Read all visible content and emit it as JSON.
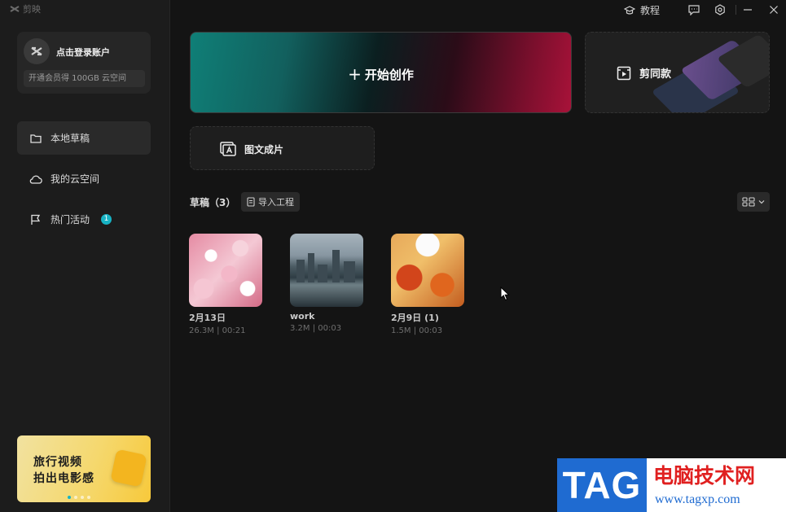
{
  "app": {
    "name": "剪映"
  },
  "topbar": {
    "tutorial_label": "教程"
  },
  "sidebar": {
    "login_label": "点击登录账户",
    "vip_text": "开通会员得 100GB 云空间",
    "items": [
      {
        "label": "本地草稿",
        "icon": "folder-icon",
        "active": true
      },
      {
        "label": "我的云空间",
        "icon": "cloud-icon",
        "active": false
      },
      {
        "label": "热门活动",
        "icon": "flag-icon",
        "active": false,
        "badge": "1"
      }
    ],
    "promo": {
      "line1": "旅行视频",
      "line2": "拍出电影感"
    }
  },
  "main": {
    "create_label": "开始创作",
    "template_label": "剪同款",
    "img2vid_label": "图文成片",
    "drafts_title": "草稿（3）",
    "import_label": "导入工程"
  },
  "drafts": [
    {
      "name": "2月13日",
      "meta": "26.3M | 00:21"
    },
    {
      "name": "work",
      "meta": "3.2M | 00:03"
    },
    {
      "name": "2月9日 (1)",
      "meta": "1.5M | 00:03"
    }
  ],
  "watermark": {
    "tag": "TAG",
    "site_name": "电脑技术网",
    "url": "www.tagxp.com"
  },
  "colors": {
    "accent": "#17b3c4",
    "background": "#141414",
    "sidebar": "#1c1c1c"
  }
}
